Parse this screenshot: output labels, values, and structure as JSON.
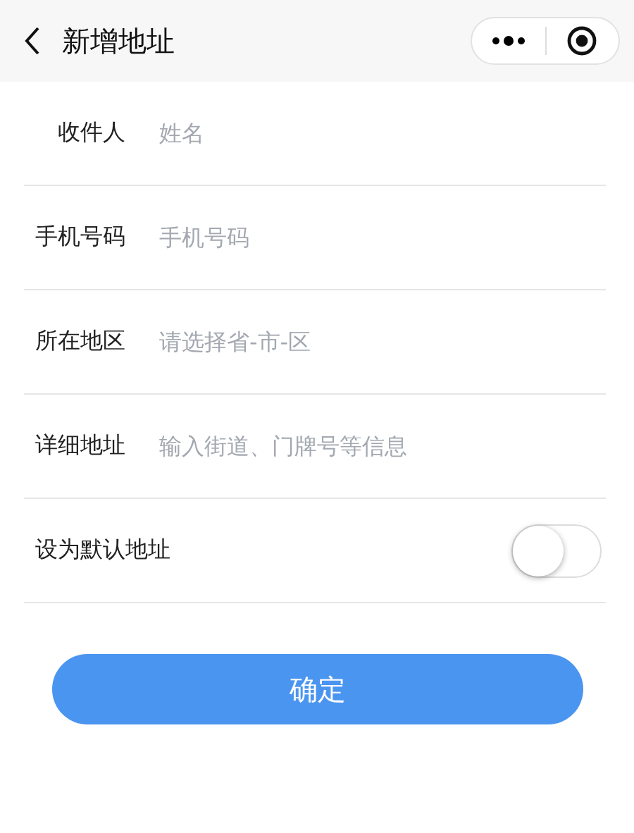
{
  "nav": {
    "title": "新增地址"
  },
  "fields": [
    {
      "label": "收件人",
      "placeholder": "姓名"
    },
    {
      "label": "手机号码",
      "placeholder": "手机号码"
    },
    {
      "label": "所在地区",
      "placeholder": "请选择省-市-区"
    },
    {
      "label": "详细地址",
      "placeholder": "输入街道、门牌号等信息"
    }
  ],
  "default_address": {
    "label": "设为默认地址",
    "on": false
  },
  "submit": {
    "label": "确定"
  }
}
